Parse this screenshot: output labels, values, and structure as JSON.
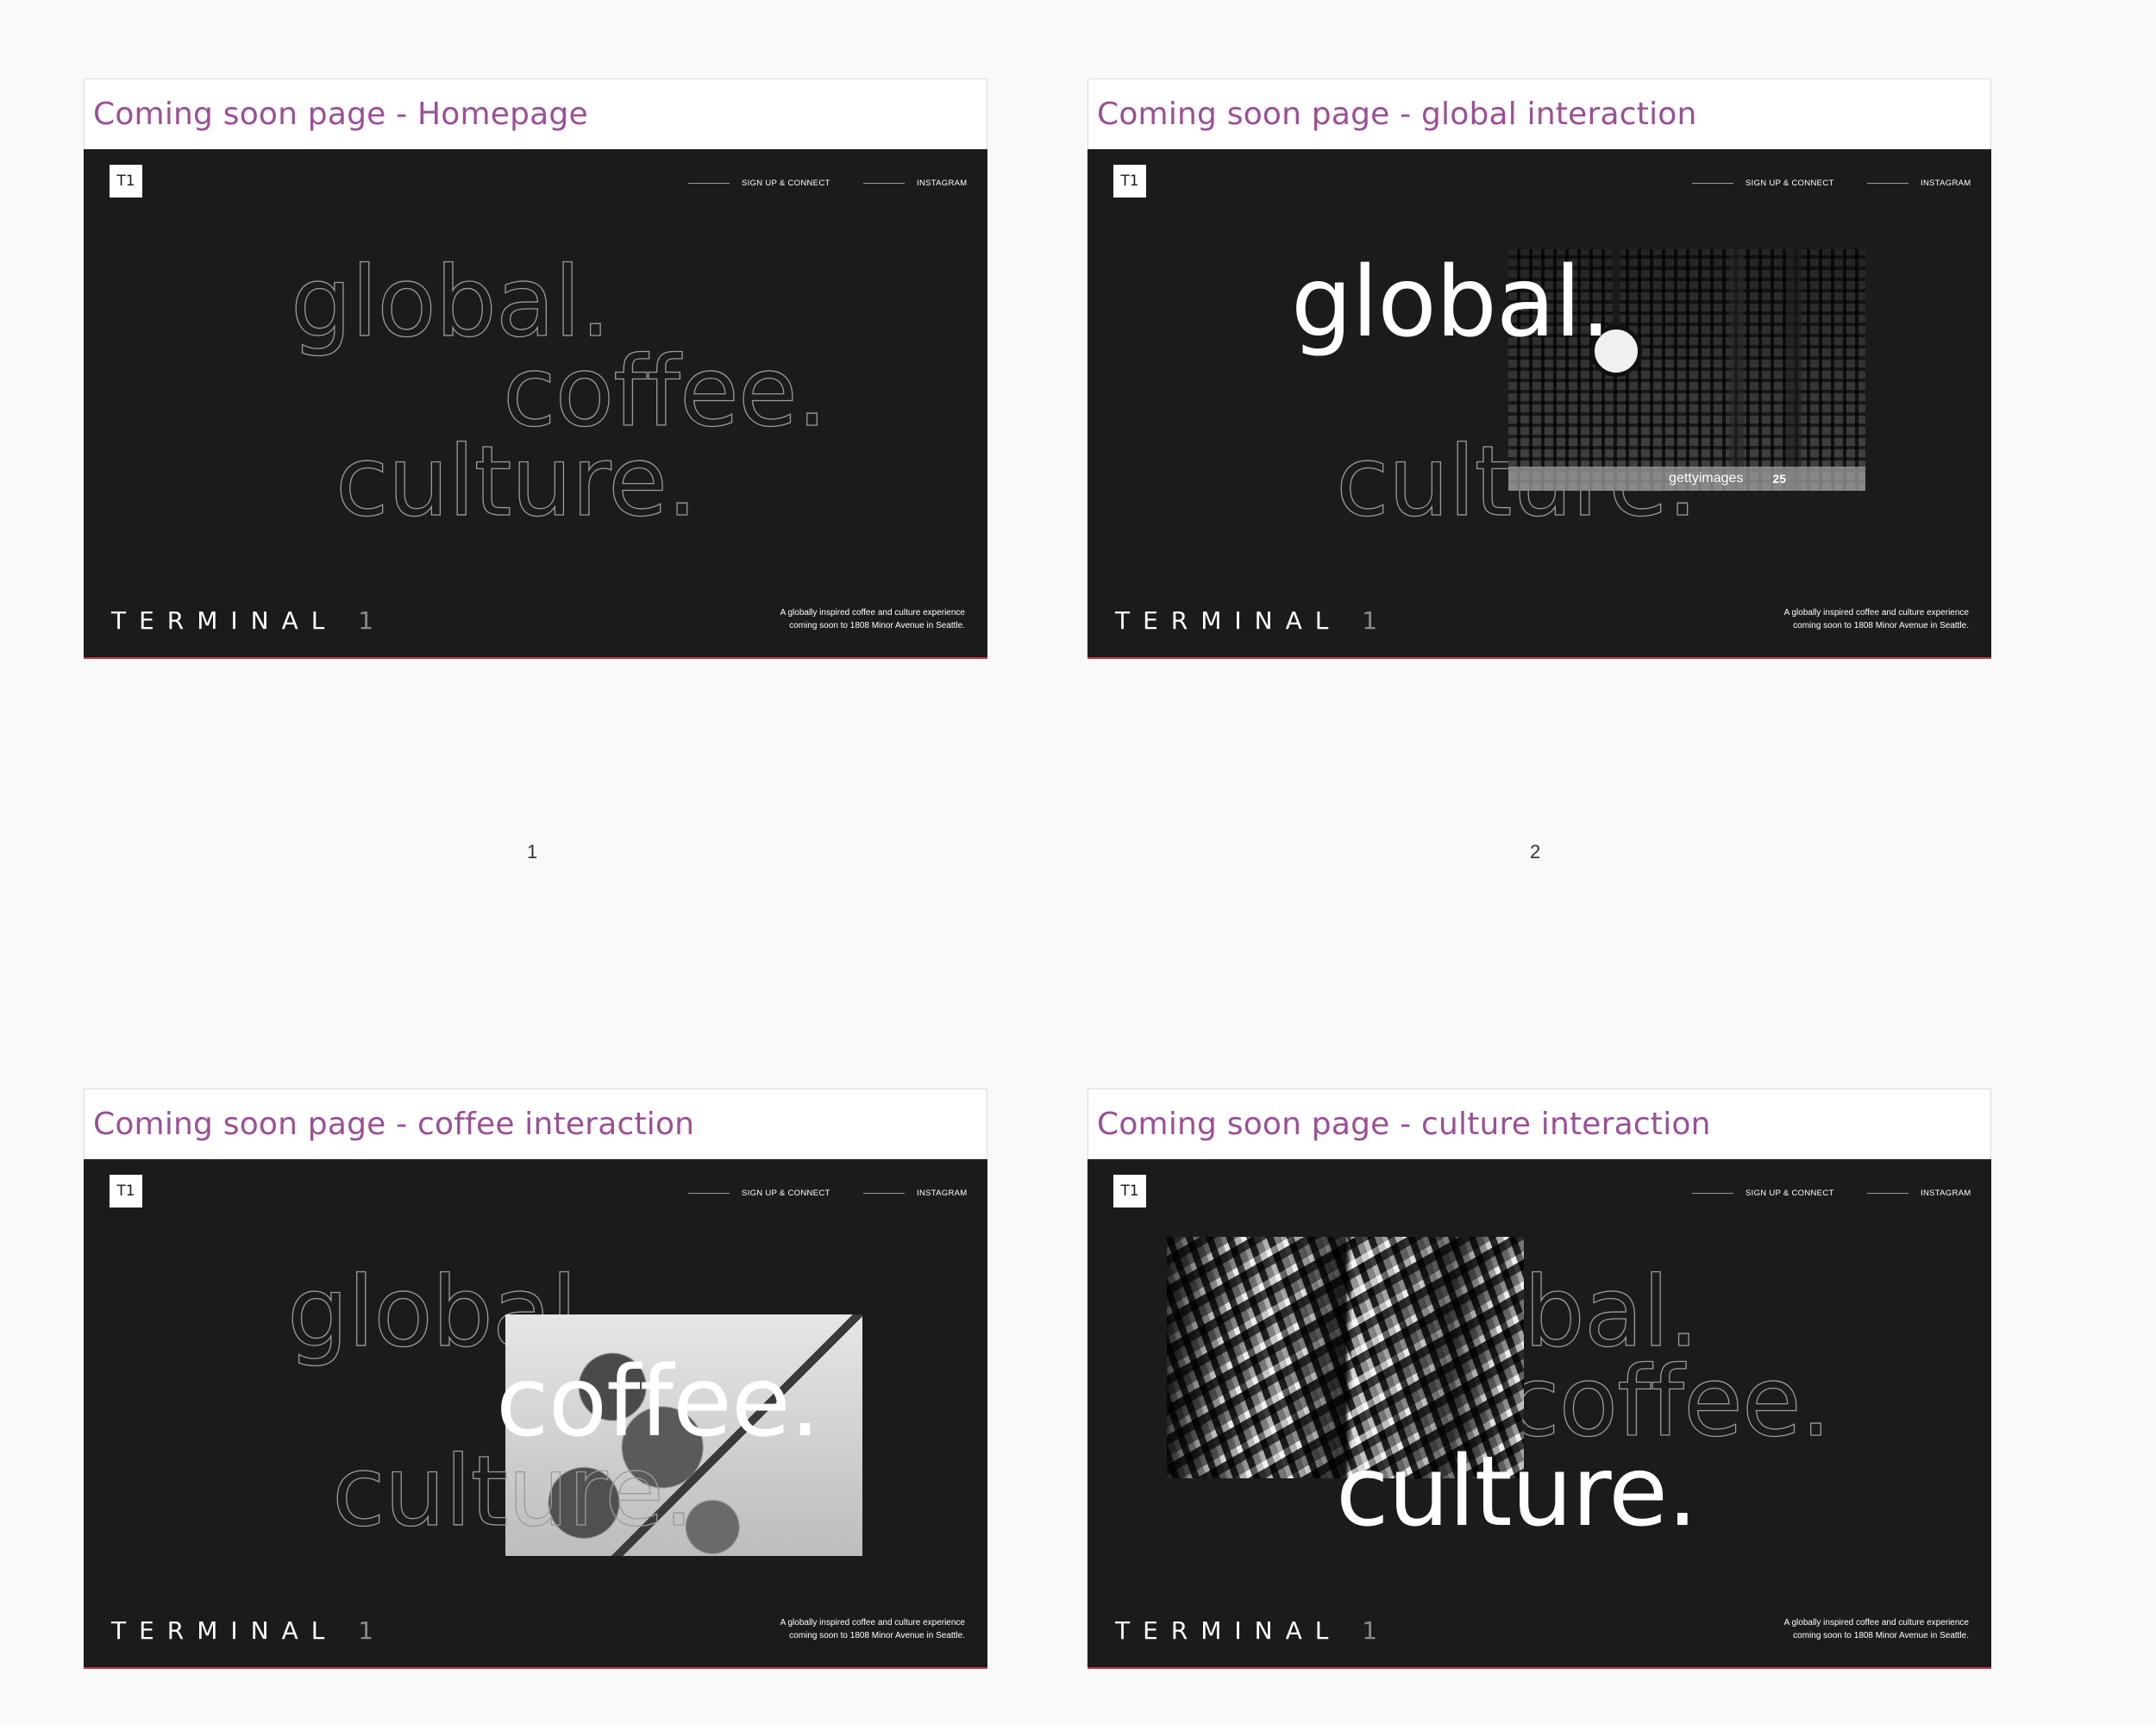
{
  "nav": {
    "signup": "SIGN UP  & CONNECT",
    "instagram": "INSTAGRAM"
  },
  "logo": "T1",
  "brand": {
    "name": "TERMINAL",
    "number": "1"
  },
  "tagline": {
    "line1": "A globally inspired coffee and culture experience",
    "line2": "coming soon to 1808 Minor Avenue in Seattle."
  },
  "words": {
    "global": "global.",
    "coffee": "coffee.",
    "culture": "culture."
  },
  "panels": [
    {
      "title": "Coming soon page -  Homepage",
      "page_number": "1"
    },
    {
      "title": "Coming soon page -  global interaction",
      "page_number": "2",
      "watermark": "gettyimages",
      "watermark_num": "25"
    },
    {
      "title": "Coming soon page -  coffee interaction"
    },
    {
      "title": "Coming soon page -  culture interaction"
    }
  ],
  "colors": {
    "title": "#9b4f96",
    "screen_bg": "#1c1b1c",
    "accent_border": "#c0394b",
    "page_bg": "#f9f9f9"
  }
}
